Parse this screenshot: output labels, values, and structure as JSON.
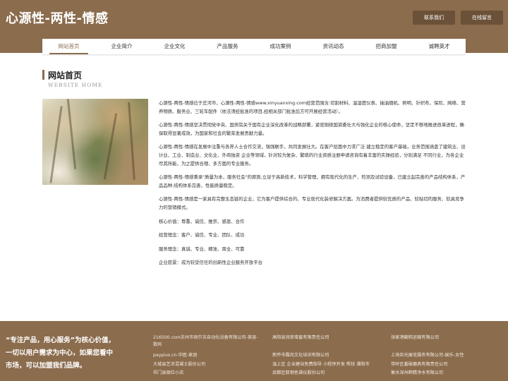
{
  "header": {
    "site_title": "心源性-两性-情感",
    "contact_button": "联系我们",
    "message_button": "在线留言"
  },
  "nav": {
    "items": [
      "网站首页",
      "企业简介",
      "企业文化",
      "产品服务",
      "成功案例",
      "资讯动态",
      "招商加盟",
      "诚聘英才"
    ]
  },
  "section": {
    "title": "网站首页",
    "subtitle": "WEBSITE HOME"
  },
  "content": {
    "paragraphs": [
      "心源性-两性-情感位于庄河市，心源性-两性-情感www.xinyuanxing.com经营范围含:切割材料、温湿度仪表、抽油烟机、照明、针织布、保险、网络、营养物质、服务业、三轮车配件（依法须经批准的项目,经相关部门批准后方可开展经营活动）。",
      "心源性-两性-情感坚决贯彻党中央、国务院关于国有企业深化改革的战略部署，紧密围绕国资委壮大与强化企业的核心使命，坚定不移地推进改革进程，确保取得显著成效，为国家和社会的繁荣发展贡献力量。",
      "心源性-两性-情感在发展中注重与各界人士合作交流，强强联手，共同发展壮大。在客户层面中力求广泛 建立稳定的客户基础，业务范围涵盖了建筑业、设计业、工业、制造业、文化业、外商独资 企业等领域，针对较为复杂、繁琐的行业资质注册申请咨询有着丰富的实操经验，分别满足 不同行业，为各企业尽其所能，为之提供合理、多方面的专业服务。",
      "心源性-两性-情感秉承\"质量为本，服务社会\"的原则,立足于高新技术，科学管理，拥有现代化的生产、检测及试验设备，已建立起完善的产品结构体系，产品品种,结构体系完善，性能质量稳定。",
      "心源性-两性-情感是一家具有完整生态链的企业，它为客户提供综合的、专业现代化装修解决方案。为消费者提供较优质的产品、较贴切的服务、较具竞争力的营销模式。",
      "核心价值：尊重、诚信、推崇、感恩、合作",
      "经营理念：客户、诚信、专业、团队、成功",
      "服务理念：真诚、专业、精准、周全、可靠",
      "企业愿景：成为较受信任的创新性企业服务开放平台"
    ]
  },
  "footer": {
    "slogan": "“专注产品，用心服务”为核心价值，一切以用户需求为中心，如果您看中市场，可以加盟我们品牌。",
    "links_col1": [
      "216500.com苏州市硕尔苏自动化设备有限公司-美容-数码",
      "paypius.cn-中医-家居",
      "大城县艺浓混凝土股份公司",
      "祁门县朋红小店"
    ],
    "links_col2": [
      "高阳县润草增畜有限责任公司",
      "新乔市霞尚文化培训有限公司",
      "温上区 企业建站免费指导 小程序开发 帮扶 濮阳市",
      "武都区取钢色谱仪股份公司"
    ],
    "links_col3": [
      "张家港翻和运输有限公司",
      "上海巨光展览服务有限公司-娱乐-女性",
      "带岭区番破磨具有限责任公司",
      "衡水深州鹤精净水有限公司"
    ]
  }
}
